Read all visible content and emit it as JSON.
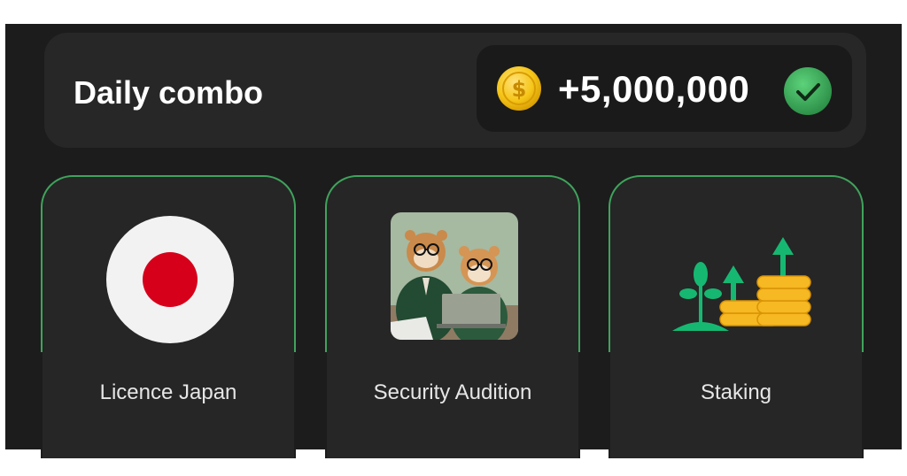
{
  "header": {
    "title": "Daily combo",
    "reward_amount": "+5,000,000",
    "reward_status": "claimed"
  },
  "cards": [
    {
      "label": "Licence Japan",
      "icon": "japan-flag-icon"
    },
    {
      "label": "Security Audition",
      "icon": "hamsters-audit-image"
    },
    {
      "label": "Staking",
      "icon": "staking-growth-icon"
    }
  ],
  "colors": {
    "background": "#1c1c1c",
    "panel": "#272727",
    "card_border": "#3fa35c",
    "coin": "#f5c518",
    "check": "#3aa655",
    "flag_red": "#d7001b",
    "staking_green": "#16b871",
    "staking_gold": "#f6b823"
  }
}
